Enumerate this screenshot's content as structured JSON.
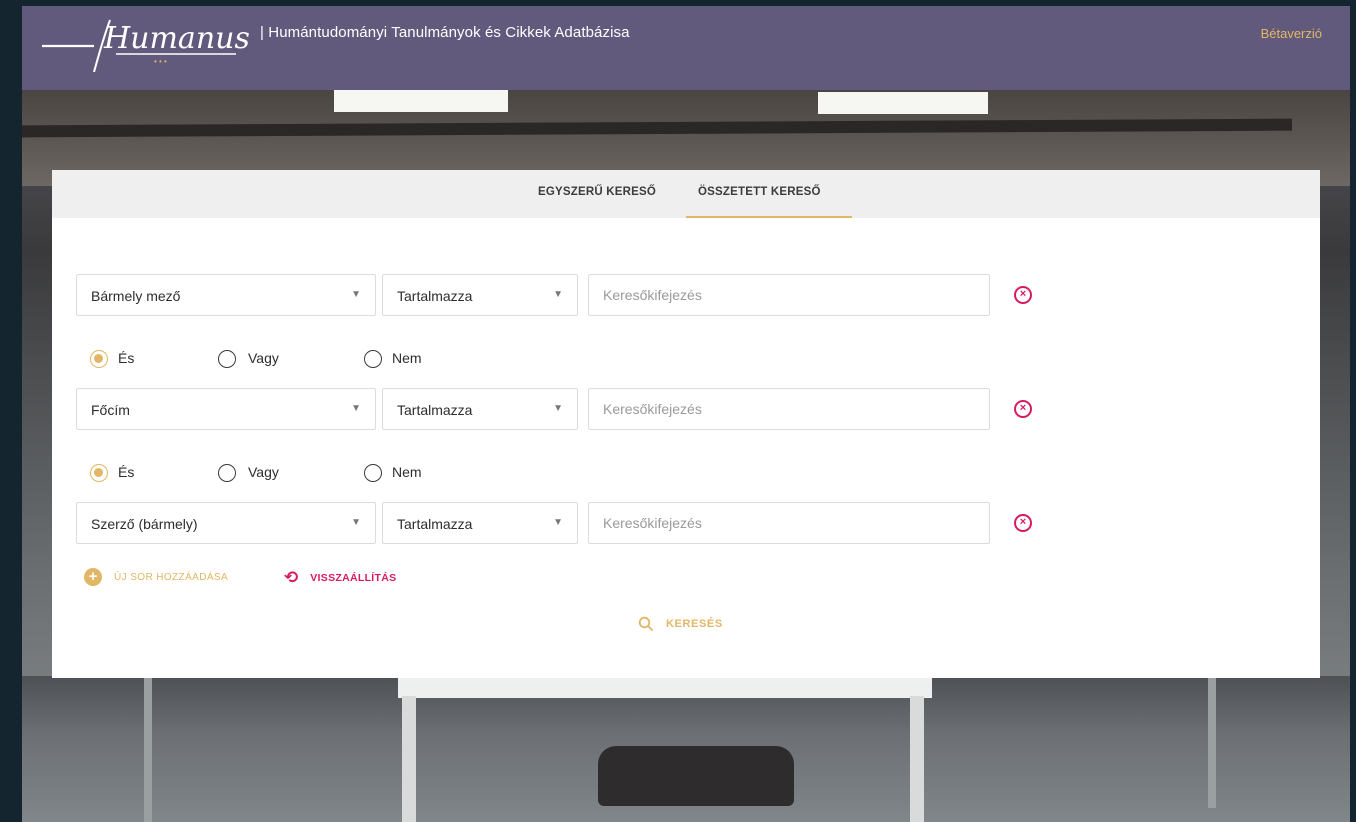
{
  "header": {
    "logo_text": "Humanus",
    "subtitle": "| Humántudományi Tanulmányok és Cikkek Adatbázisa",
    "beta_label": "Bétaverzió"
  },
  "tabs": [
    {
      "label": "EGYSZERŰ KERESŐ",
      "active": false
    },
    {
      "label": "ÖSSZETETT KERESŐ",
      "active": true
    }
  ],
  "query_rows": [
    {
      "field": "Bármely mező",
      "operator": "Tartalmazza",
      "value": "",
      "placeholder": "Keresőkifejezés"
    },
    {
      "field": "Főcím",
      "operator": "Tartalmazza",
      "value": "",
      "placeholder": "Keresőkifejezés"
    },
    {
      "field": "Szerző (bármely)",
      "operator": "Tartalmazza",
      "value": "",
      "placeholder": "Keresőkifejezés"
    }
  ],
  "connectors": [
    {
      "options": [
        "És",
        "Vagy",
        "Nem"
      ],
      "selected": "És"
    },
    {
      "options": [
        "És",
        "Vagy",
        "Nem"
      ],
      "selected": "És"
    }
  ],
  "actions": {
    "add_row_label": "ÚJ SOR HOZZÁADÁSA",
    "reset_label": "VISSZAÁLLÍTÁS",
    "search_label": "KERESÉS"
  },
  "colors": {
    "header_bg": "#625a7d",
    "accent_gold": "#e1b765",
    "accent_magenta": "#d81b60"
  },
  "icons": {
    "remove": "close-circle-icon",
    "caret": "caret-down-icon",
    "add": "plus-circle-icon",
    "reset": "reset-icon",
    "search": "search-icon"
  }
}
